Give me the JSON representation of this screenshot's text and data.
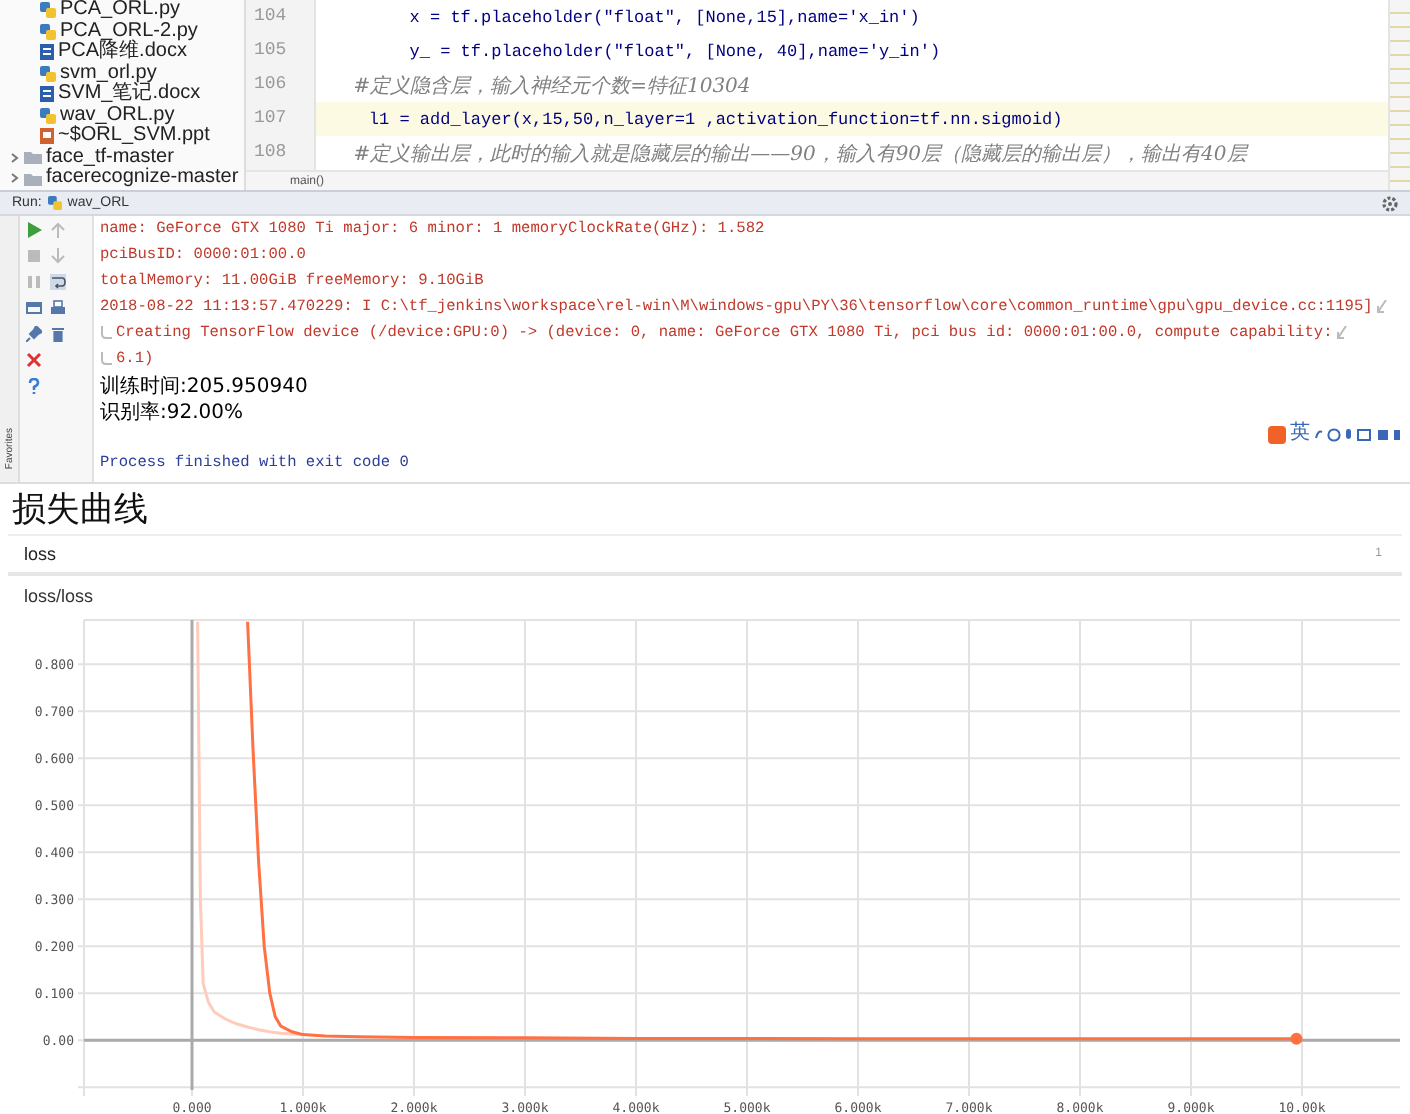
{
  "project_tree": {
    "items": [
      {
        "name": "PCA_ORL.py",
        "kind": "py"
      },
      {
        "name": "PCA_ORL-2.py",
        "kind": "py"
      },
      {
        "name": "PCA降维.docx",
        "kind": "doc"
      },
      {
        "name": "svm_orl.py",
        "kind": "py"
      },
      {
        "name": "SVM_笔记.docx",
        "kind": "doc"
      },
      {
        "name": "wav_ORL.py",
        "kind": "py"
      },
      {
        "name": "~$ORL_SVM.ppt",
        "kind": "ppt"
      },
      {
        "name": "face_tf-master",
        "kind": "folder",
        "expanded": false
      },
      {
        "name": "facerecognize-master",
        "kind": "folder",
        "expanded": false
      }
    ]
  },
  "editor": {
    "lines": [
      {
        "number": "104",
        "text": "        x = tf.placeholder(\"float\", [None,15],name='x_in')",
        "kind": "code",
        "current": false
      },
      {
        "number": "105",
        "text": "        y_ = tf.placeholder(\"float\", [None, 40],name='y_in')",
        "kind": "code",
        "current": false
      },
      {
        "number": "106",
        "text": "    #定义隐含层，输入神经元个数=特征10304",
        "kind": "comment",
        "current": false
      },
      {
        "number": "107",
        "text": "    l1 = add_layer(x,15,50,n_layer=1 ,activation_function=tf.nn.sigmoid)",
        "kind": "code",
        "current": true
      },
      {
        "number": "108",
        "text": "    #定义输出层，此时的输入就是隐藏层的输出——90，输入有90层（隐藏层的输出层），输出有40层",
        "kind": "comment",
        "current": false
      }
    ],
    "breadcrumb": "main()"
  },
  "run_panel": {
    "label": "Run:",
    "config": "wav_ORL",
    "favorites_label": "Favorites",
    "console": [
      {
        "text": "name: GeForce GTX 1080 Ti major: 6 minor: 1 memoryClockRate(GHz): 1.582",
        "kind": "stderr",
        "wrap_start": false,
        "wrap_end": false
      },
      {
        "text": "pciBusID: 0000:01:00.0",
        "kind": "stderr",
        "wrap_start": false,
        "wrap_end": false
      },
      {
        "text": "totalMemory: 11.00GiB freeMemory: 9.10GiB",
        "kind": "stderr",
        "wrap_start": false,
        "wrap_end": false
      },
      {
        "text": "2018-08-22 11:13:57.470229: I C:\\tf_jenkins\\workspace\\rel-win\\M\\windows-gpu\\PY\\36\\tensorflow\\core\\common_runtime\\gpu\\gpu_device.cc:1195]",
        "kind": "stderr",
        "wrap_start": false,
        "wrap_end": true
      },
      {
        "text": "Creating TensorFlow device (/device:GPU:0) -> (device: 0, name: GeForce GTX 1080 Ti, pci bus id: 0000:01:00.0, compute capability:",
        "kind": "stderr",
        "wrap_start": true,
        "wrap_end": true
      },
      {
        "text": "6.1)",
        "kind": "stderr",
        "wrap_start": true,
        "wrap_end": false
      },
      {
        "text": "训练时间:205.950940",
        "kind": "stdout",
        "wrap_start": false,
        "wrap_end": false
      },
      {
        "text": "识别率:92.00%",
        "kind": "stdout",
        "wrap_start": false,
        "wrap_end": false
      },
      {
        "kind": "blank"
      },
      {
        "text": "Process finished with exit code 0",
        "kind": "exit",
        "wrap_start": false,
        "wrap_end": false
      }
    ]
  },
  "ime_toolbar": {
    "mode": "英"
  },
  "heading": "损失曲线",
  "scalar_card": {
    "title": "loss",
    "count": "1",
    "chart_data": {
      "type": "line",
      "title": "loss/loss",
      "x": [
        50,
        75,
        100,
        150,
        200,
        300,
        400,
        500,
        550,
        600,
        650,
        700,
        750,
        800,
        900,
        1000,
        1200,
        1500,
        2000,
        3000,
        4000,
        5000,
        6000,
        7000,
        8000,
        9000,
        9950
      ],
      "series": [
        {
          "color": "#ff7043",
          "values": [
            null,
            null,
            null,
            null,
            null,
            null,
            null,
            0.89,
            0.62,
            0.38,
            0.2,
            0.1,
            0.05,
            0.03,
            0.018,
            0.012,
            0.009,
            0.007,
            0.006,
            0.005,
            0.004,
            0.004,
            0.003,
            0.003,
            0.003,
            0.003,
            0.003
          ]
        },
        {
          "color": "#ffccbc",
          "values": [
            0.89,
            0.3,
            0.12,
            0.08,
            0.06,
            0.045,
            0.035,
            0.028,
            0.025,
            0.022,
            0.02,
            0.018,
            0.016,
            0.015,
            0.013,
            0.011,
            null,
            null,
            null,
            null,
            null,
            null,
            null,
            null,
            null,
            null,
            null
          ]
        }
      ],
      "grid": true,
      "xlim": [
        -973,
        10883
      ],
      "ylim": [
        -0.106,
        0.894
      ],
      "xticks": [
        {
          "value": 0,
          "label": "0.000"
        },
        {
          "value": 1000,
          "label": "1.000k"
        },
        {
          "value": 2000,
          "label": "2.000k"
        },
        {
          "value": 3000,
          "label": "3.000k"
        },
        {
          "value": 4000,
          "label": "4.000k"
        },
        {
          "value": 5000,
          "label": "5.000k"
        },
        {
          "value": 6000,
          "label": "6.000k"
        },
        {
          "value": 7000,
          "label": "7.000k"
        },
        {
          "value": 8000,
          "label": "8.000k"
        },
        {
          "value": 9000,
          "label": "9.000k"
        },
        {
          "value": 10000,
          "label": "10.00k"
        }
      ],
      "yticks": [
        {
          "value": 0,
          "label": "0.00"
        },
        {
          "value": 0.1,
          "label": "0.100"
        },
        {
          "value": 0.2,
          "label": "0.200"
        },
        {
          "value": 0.3,
          "label": "0.300"
        },
        {
          "value": 0.4,
          "label": "0.400"
        },
        {
          "value": 0.5,
          "label": "0.500"
        },
        {
          "value": 0.6,
          "label": "0.600"
        },
        {
          "value": 0.7,
          "label": "0.700"
        },
        {
          "value": 0.8,
          "label": "0.800"
        }
      ]
    }
  }
}
